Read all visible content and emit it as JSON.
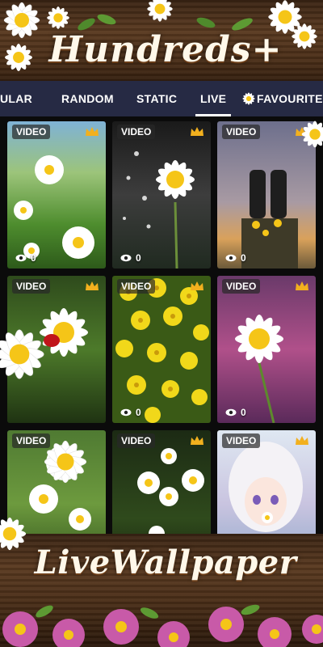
{
  "banner": {
    "title": "Hundreds+"
  },
  "tabs": [
    {
      "label": "ULAR"
    },
    {
      "label": "RANDOM"
    },
    {
      "label": "STATIC"
    },
    {
      "label": "LIVE",
      "active": true
    },
    {
      "label": "FAVOURITE"
    }
  ],
  "cards": [
    {
      "badge": "VIDEO",
      "premium": true,
      "views": "0"
    },
    {
      "badge": "VIDEO",
      "premium": true,
      "views": "0"
    },
    {
      "badge": "VIDEO",
      "premium": true,
      "views": "0"
    },
    {
      "badge": "VIDEO",
      "premium": true,
      "views": ""
    },
    {
      "badge": "VIDEO",
      "premium": true,
      "views": "0"
    },
    {
      "badge": "VIDEO",
      "premium": true,
      "views": "0"
    },
    {
      "badge": "VIDEO",
      "premium": false,
      "views": ""
    },
    {
      "badge": "VIDEO",
      "premium": true,
      "views": ""
    },
    {
      "badge": "VIDEO",
      "premium": true,
      "views": ""
    }
  ],
  "footer": {
    "title": "LiveWallpaper"
  },
  "colors": {
    "tabbar": "#262a44",
    "crown": "#f2b01e",
    "wood": "#5a3a20",
    "daisy_petal": "#ffffff",
    "daisy_center": "#f5c518",
    "pink_flower": "#c85aa8"
  }
}
